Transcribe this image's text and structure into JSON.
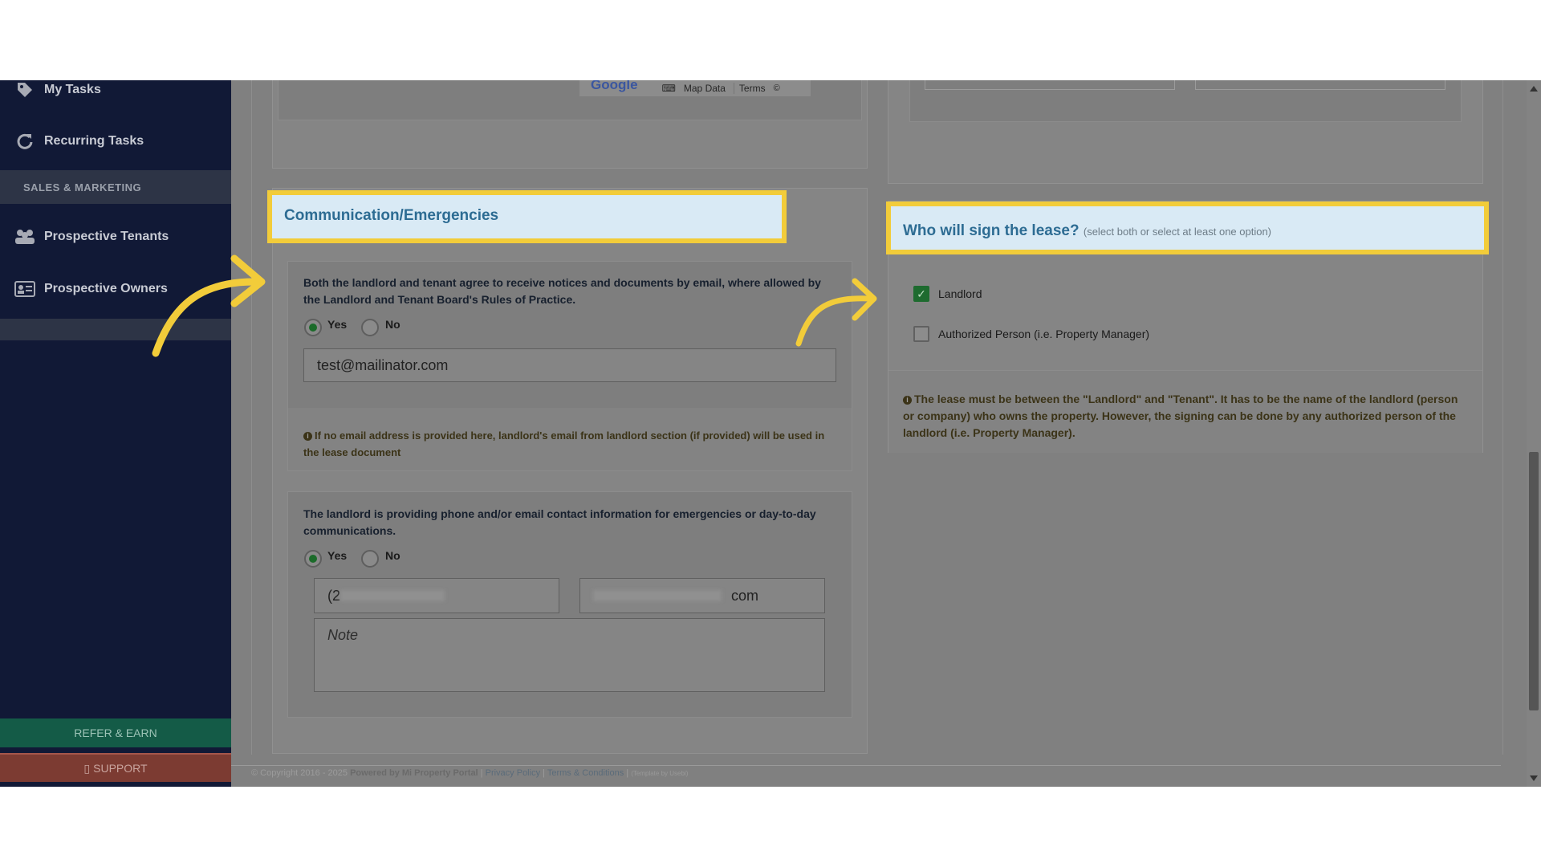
{
  "sidebar": {
    "items": [
      {
        "label": "My Tasks",
        "icon": "tag-icon"
      },
      {
        "label": "Recurring Tasks",
        "icon": "refresh-icon"
      },
      {
        "label": "Prospective Tenants",
        "icon": "users-icon"
      },
      {
        "label": "Prospective Owners",
        "icon": "id-card-icon"
      }
    ],
    "section_label": "SALES & MARKETING",
    "refer_label": "REFER & EARN",
    "support_label": "SUPPORT"
  },
  "map": {
    "google_label": "Google",
    "map_data_label": "Map Data",
    "terms_label": "Terms"
  },
  "communication": {
    "title": "Communication/Emergencies",
    "email_question": "Both the landlord and tenant agree to receive notices and documents by email, where allowed by the Landlord and Tenant Board's Rules of Practice.",
    "yes_label": "Yes",
    "no_label": "No",
    "email_value": "test@mailinator.com",
    "email_info": "If no email address is provided here, landlord's email from landlord section (if provided) will be used in the lease document",
    "emergency_question": "The landlord is providing phone and/or email contact information for emergencies or day-to-day communications.",
    "phone_value": "(2",
    "contact_email_value": "com",
    "note_placeholder": "Note"
  },
  "signers": {
    "title": "Who will sign the lease?",
    "hint": "(select both or select at least one option)",
    "landlord_label": "Landlord",
    "authorized_label": "Authorized Person (i.e. Property Manager)",
    "landlord_checked": true,
    "authorized_checked": false,
    "info": "The lease must be between the \"Landlord\" and \"Tenant\". It has to be the name of the landlord (person or company) who owns the property. However, the signing can be done by any authorized person of the landlord (i.e. Property Manager)."
  },
  "footer": {
    "copyright": "© Copyright 2016 - 2025",
    "powered": "Powered by Mi Property Portal",
    "privacy": "Privacy Policy",
    "terms": "Terms & Conditions",
    "template": "(Template by Usebi)"
  },
  "colors": {
    "highlight_border": "#f2cc3a",
    "annotation_arrow": "#f2cc3a",
    "sidebar_bg": "#111936"
  }
}
